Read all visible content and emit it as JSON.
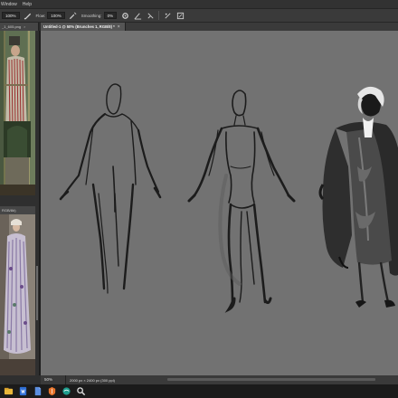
{
  "menubar": {
    "items": [
      "Window",
      "Help"
    ]
  },
  "options": {
    "size_value": "100%",
    "flow_label": "Flow:",
    "flow_value": "100%",
    "smoothing_label": "Smoothing:",
    "smoothing_value": "0%"
  },
  "tabs": {
    "left_doc1": "_1_605.png",
    "left_doc2": "RGB/8#)",
    "main": "Untitled-1 @ 50% (Brunches 1, RGB/8) *"
  },
  "status": {
    "zoom": "50%",
    "dimensions": "2000 px × 2400 px (300 ppi)"
  },
  "colors": {
    "canvas_bg": "#727272",
    "panel_bg": "#2b2b2b",
    "sketch_stroke": "#1a1a1a",
    "accent_orange": "#e8742a",
    "accent_blue": "#2f6fd6"
  },
  "icons": {
    "brush": "brush-icon",
    "airbrush": "airbrush-icon",
    "angle": "angle-icon",
    "pressure": "pressure-icon",
    "symmetry": "symmetry-icon"
  }
}
